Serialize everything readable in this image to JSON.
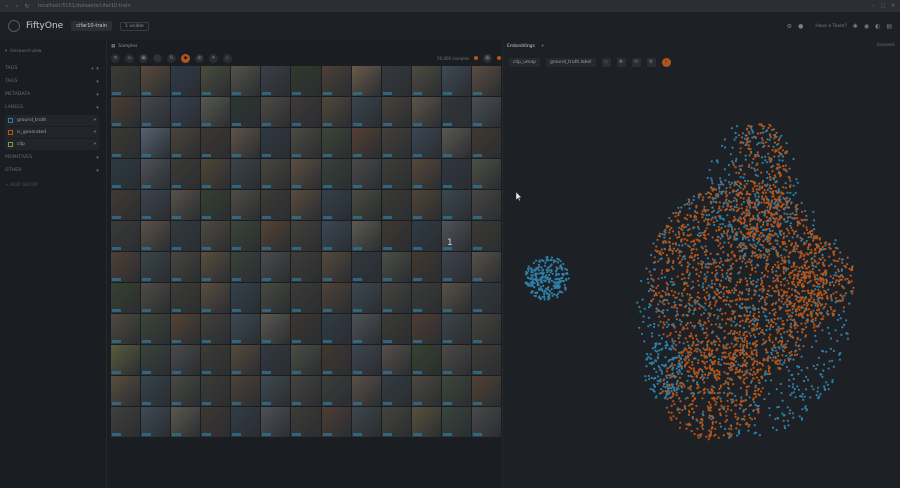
{
  "browser": {
    "url": "localhost:5151/datasets/cifar10-train",
    "controls": [
      "–",
      "□",
      "✕"
    ]
  },
  "app": {
    "title": "FiftyOne",
    "dataset": "cifar10-train",
    "badge": "1 visible",
    "links": {
      "community": "Have a Team?"
    },
    "icons": [
      "settings-icon",
      "info-icon"
    ]
  },
  "sidebar": {
    "search_placeholder": "Unsaved view",
    "sections": [
      {
        "id": "tags",
        "label": "TAGS",
        "right": "+ ▾"
      },
      {
        "id": "tags2",
        "label": "TAGS",
        "right": "▾"
      },
      {
        "id": "metadata",
        "label": "METADATA",
        "right": "▾"
      },
      {
        "id": "labels",
        "label": "LABELS",
        "right": "▾"
      }
    ],
    "label_fields": [
      {
        "name": "ground_truth",
        "color": "#2f7fa8"
      },
      {
        "name": "is_generated",
        "color": "#b2561d"
      },
      {
        "name": "clip",
        "color": "#7a9a4a"
      }
    ],
    "more_sections": [
      {
        "id": "primitives",
        "label": "PRIMITIVES"
      },
      {
        "id": "other",
        "label": "OTHER"
      }
    ],
    "add_group": "+ ADD GROUP"
  },
  "samples": {
    "tab_label": "Samples",
    "count_text": "50,000 samples",
    "tile_colors": [
      "#3b3a34",
      "#5a4a3b",
      "#2e3a48",
      "#4a4d3c",
      "#55524a",
      "#3a3f47",
      "#2f3a2c",
      "#4d4036",
      "#6a5a4a",
      "#34393f",
      "#4e4b40",
      "#3d4a55",
      "#5b4c3f",
      "#4a3d33",
      "#44474c",
      "#35424f",
      "#58594f",
      "#2d3630",
      "#4f4a44",
      "#3e3a37",
      "#51473a",
      "#38444c",
      "#474238",
      "#5d5448",
      "#32373b",
      "#4b4e53",
      "#3a3a31",
      "#566270",
      "#4a4438",
      "#3d3630",
      "#5f5346",
      "#2f3844",
      "#4c4a42",
      "#3b4636",
      "#533f33",
      "#44403a",
      "#3a4753",
      "#5a584f",
      "#41382f",
      "#2c3a43",
      "#4e5357",
      "#3d3a33",
      "#514536",
      "#3a4346",
      "#48463e",
      "#5c4f40",
      "#36423a",
      "#4a4a4a",
      "#3f3d38",
      "#55483a",
      "#30373f",
      "#4d5045",
      "#43392f",
      "#3b444c",
      "#58524a",
      "#344030",
      "#4f4c46",
      "#3e3a34",
      "#5a4c3e",
      "#33404b",
      "#4a4b40",
      "#3a3934",
      "#504437",
      "#3c474f",
      "#474540",
      "#3a3b38",
      "#5b5247",
      "#2f3a40",
      "#4e4a3f",
      "#3b4539",
      "#554333",
      "#42403b",
      "#3b4854",
      "#5c5a50",
      "#3f3730",
      "#2e3b44",
      "#4f5458",
      "#3c3932",
      "#503f35",
      "#3a4549",
      "#47453d",
      "#5a4d3d",
      "#37433b",
      "#4b4b4b",
      "#3e3c37",
      "#56493b",
      "#31383f",
      "#4c4f44",
      "#43382e",
      "#3c454d",
      "#57514a",
      "#36412f",
      "#4e4b45",
      "#3f3b35",
      "#5b4d3f",
      "#34414b",
      "#494a3f",
      "#3b3a35",
      "#4f4336",
      "#3d4850",
      "#46443f",
      "#3b3c39",
      "#5a5146",
      "#303b41",
      "#4d493e",
      "#3c4638",
      "#544232",
      "#41403b",
      "#3c4955",
      "#5b5950",
      "#3e3630",
      "#2f3c45",
      "#4e5357",
      "#3d3a33",
      "#4f3e34",
      "#3b464a",
      "#46443c",
      "#595c3d",
      "#38443c",
      "#4a4a4a",
      "#3d3b36",
      "#574a3c",
      "#32393f",
      "#4b4e43",
      "#42372d",
      "#3d464e",
      "#565049",
      "#37422e",
      "#4d4a44",
      "#403c36",
      "#5a4c3e",
      "#35424c",
      "#484940",
      "#3c3b36",
      "#4e4235",
      "#3e4951",
      "#45433e",
      "#3c3d3a",
      "#595045",
      "#313c42",
      "#4c483d",
      "#3d4739",
      "#534131",
      "#40403b",
      "#3d4a56",
      "#5a584f",
      "#3f3731",
      "#303d46",
      "#4d5256",
      "#3e3b34",
      "#4e3d33",
      "#3c474b",
      "#45433b",
      "#58513d",
      "#39453d",
      "#494949"
    ]
  },
  "embeddings": {
    "tabs": [
      "Embeddings",
      "+"
    ],
    "right_label": "Unsaved",
    "brain_key": "clip_umap",
    "color_by": "ground_truth.label",
    "overlay_number": "1"
  },
  "colors": {
    "accent": "#b2561d",
    "blue_points": "#2f7fa8",
    "orange_points": "#b2561d",
    "bg": "#1a1d21"
  }
}
